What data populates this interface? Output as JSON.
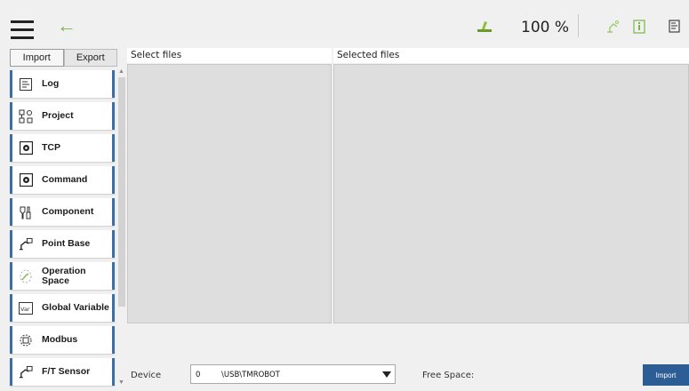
{
  "topbar": {
    "zoom": "100 %",
    "icons": [
      "menu-icon",
      "back-arrow-icon",
      "speed-icon",
      "robot-arm-icon",
      "info-icon",
      "notes-icon"
    ],
    "colors": {
      "accent_green": "#7ab648",
      "accent_blue": "#3a6ea5"
    }
  },
  "tabs": {
    "import": "Import",
    "export": "Export"
  },
  "sidebar": {
    "items": [
      {
        "label": "Log",
        "icon": "log-icon"
      },
      {
        "label": "Project",
        "icon": "project-icon"
      },
      {
        "label": "TCP",
        "icon": "tcp-icon"
      },
      {
        "label": "Command",
        "icon": "command-icon"
      },
      {
        "label": "Component",
        "icon": "component-icon"
      },
      {
        "label": "Point Base",
        "icon": "point-base-icon"
      },
      {
        "label": "Operation Space",
        "icon": "operation-space-icon"
      },
      {
        "label": "Global Variable",
        "icon": "global-variable-icon"
      },
      {
        "label": "Modbus",
        "icon": "modbus-icon"
      },
      {
        "label": "F/T Sensor",
        "icon": "ft-sensor-icon"
      }
    ]
  },
  "panels": {
    "select_files": "Select files",
    "selected_files": "Selected files"
  },
  "footer": {
    "device_label": "Device",
    "device_index": "0",
    "device_path": "\\USB\\TMROBOT",
    "free_space_label": "Free Space:",
    "import_button": "Import"
  }
}
